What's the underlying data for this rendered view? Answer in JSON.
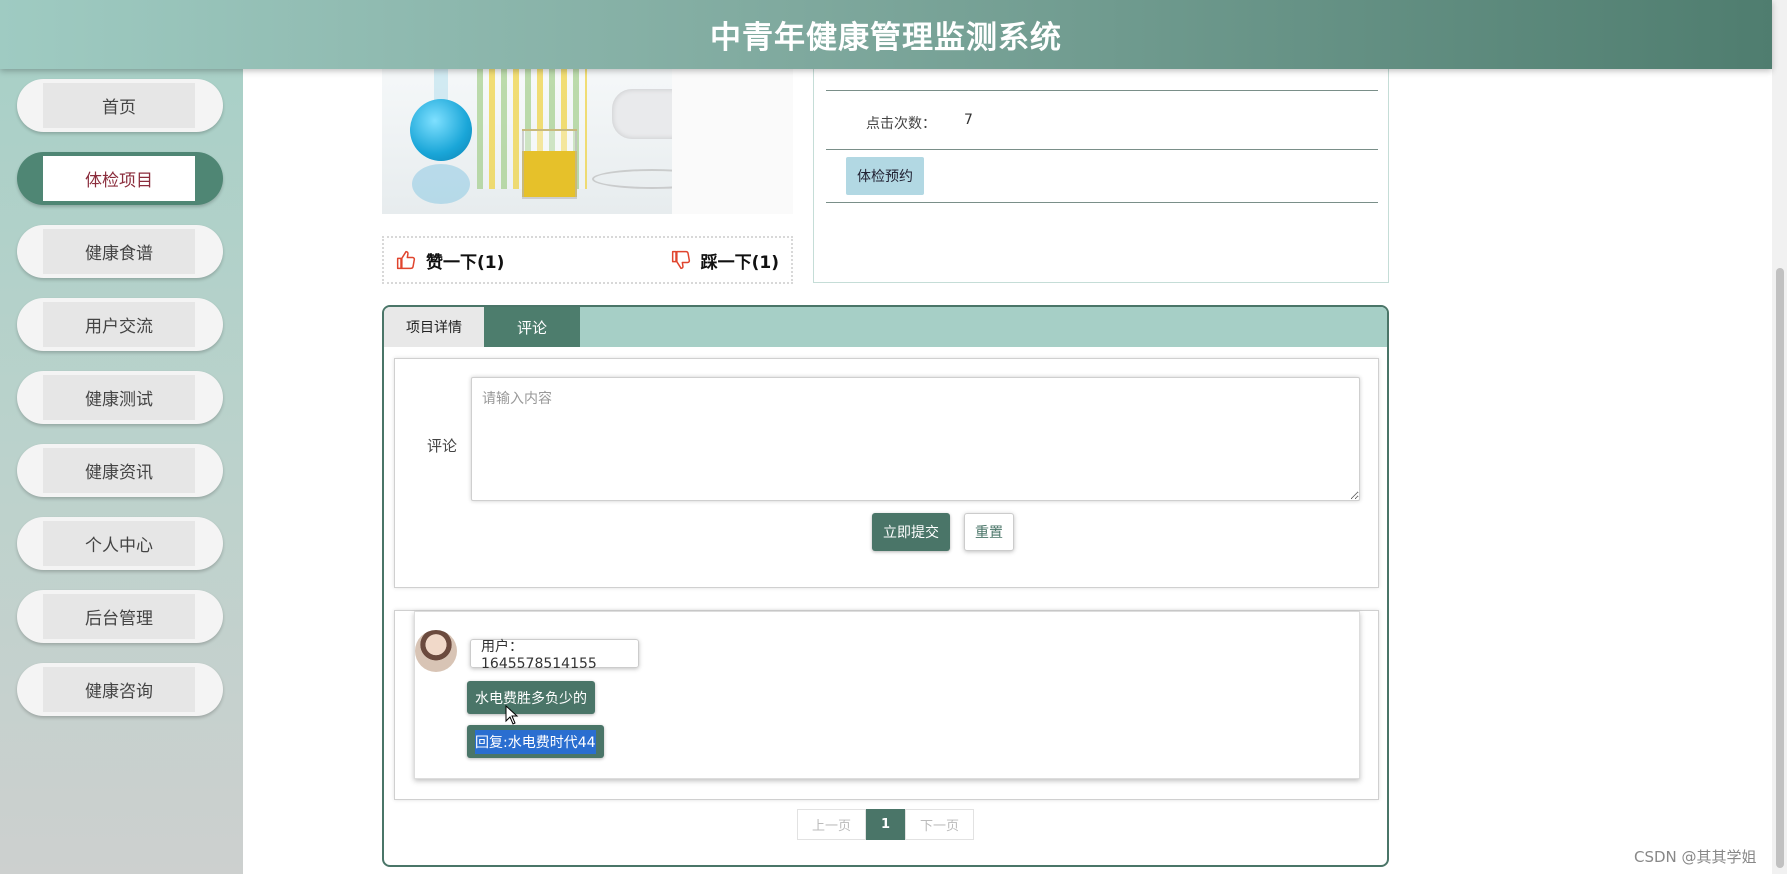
{
  "header": {
    "title": "中青年健康管理监测系统"
  },
  "sidebar": {
    "items": [
      {
        "label": "首页",
        "active": false
      },
      {
        "label": "体检项目",
        "active": true
      },
      {
        "label": "健康食谱",
        "active": false
      },
      {
        "label": "用户交流",
        "active": false
      },
      {
        "label": "健康测试",
        "active": false
      },
      {
        "label": "健康资讯",
        "active": false
      },
      {
        "label": "个人中心",
        "active": false
      },
      {
        "label": "后台管理",
        "active": false
      },
      {
        "label": "健康咨询",
        "active": false
      }
    ]
  },
  "votes": {
    "like_label": "赞一下(1)",
    "dislike_label": "踩一下(1)"
  },
  "info": {
    "clicks_label": "点击次数：",
    "clicks_value": "7",
    "book_button": "体检预约"
  },
  "tabs": [
    {
      "label": "项目详情"
    },
    {
      "label": "评论"
    }
  ],
  "comment_form": {
    "label": "评论",
    "placeholder": "请输入内容",
    "submit_label": "立即提交",
    "reset_label": "重置"
  },
  "comments": [
    {
      "user": "用户：1645578514155",
      "content": "水电费胜多负少的",
      "reply": "回复:水电费时代44"
    }
  ],
  "pagination": {
    "prev": "上一页",
    "current": "1",
    "next": "下一页"
  },
  "watermark": "CSDN @其其学姐",
  "colors": {
    "accent": "#4a7568",
    "header_start": "#9fcbc2",
    "header_end": "#4f7d6f",
    "active_text": "#8b2d3c"
  }
}
